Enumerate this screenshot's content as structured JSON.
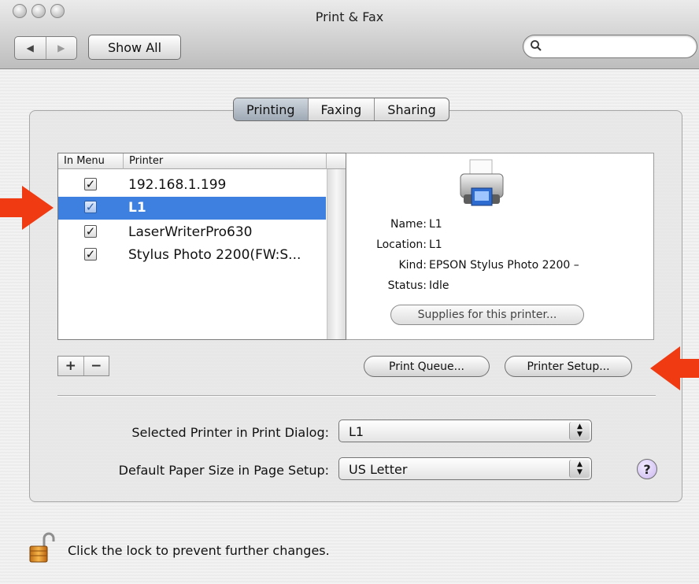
{
  "window": {
    "title": "Print & Fax"
  },
  "toolbar": {
    "back_glyph": "◀",
    "forward_glyph": "▶",
    "show_all_label": "Show All",
    "search_placeholder": ""
  },
  "tabs": [
    {
      "label": "Printing",
      "active": true
    },
    {
      "label": "Faxing",
      "active": false
    },
    {
      "label": "Sharing",
      "active": false
    }
  ],
  "printer_list": {
    "columns": [
      "In Menu",
      "Printer"
    ],
    "rows": [
      {
        "in_menu": true,
        "name": "192.168.1.199",
        "selected": false
      },
      {
        "in_menu": true,
        "name": "L1",
        "selected": true
      },
      {
        "in_menu": true,
        "name": "LaserWriterPro630",
        "selected": false
      },
      {
        "in_menu": true,
        "name": "Stylus Photo 2200(FW:S...",
        "selected": false
      }
    ],
    "check_glyph": "✓",
    "add_label": "+",
    "remove_label": "−"
  },
  "details": {
    "name_label": "Name:",
    "name_value": "L1",
    "location_label": "Location:",
    "location_value": "L1",
    "kind_label": "Kind:",
    "kind_value": "EPSON Stylus Photo 2200 –",
    "status_label": "Status:",
    "status_value": "Idle",
    "supplies_button": "Supplies for this printer..."
  },
  "actions": {
    "print_queue": "Print Queue...",
    "printer_setup": "Printer Setup..."
  },
  "settings": {
    "selected_printer_label": "Selected Printer in Print Dialog:",
    "selected_printer_value": "L1",
    "paper_size_label": "Default Paper Size in Page Setup:",
    "paper_size_value": "US Letter",
    "help_label": "?"
  },
  "footer": {
    "lock_text": "Click the lock to prevent further changes."
  },
  "colors": {
    "selection": "#3d80df",
    "annotation_arrow": "#f03a12",
    "active_tab": "#aab4bf"
  }
}
